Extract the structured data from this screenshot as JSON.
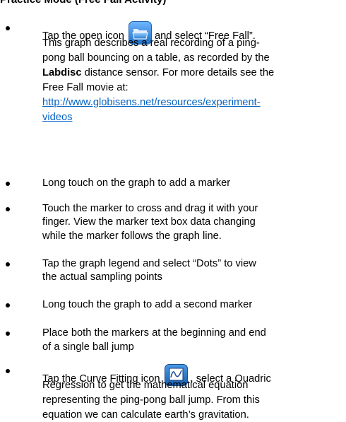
{
  "header_fragment": "Practice Mode (Free Fall Activity)",
  "items": [
    {
      "lines": [
        {
          "segments": [
            {
              "text": "Tap the open icon"
            },
            {
              "icon": "open-icon"
            },
            {
              "text": "and select “Free Fall”."
            }
          ]
        },
        {
          "segments": [
            {
              "text": "This graph describes a real recording of a ping-"
            }
          ]
        },
        {
          "segments": [
            {
              "text": "pong ball bouncing on a table, as recorded by the"
            }
          ]
        },
        {
          "segments": [
            {
              "text": "Labdisc",
              "bold": true
            },
            {
              "text": " distance sensor. For more details see the"
            }
          ]
        },
        {
          "segments": [
            {
              "text": "Free Fall movie at:"
            }
          ]
        },
        {
          "segments": [
            {
              "text": "http://www.globisens.net/resources/experiment-",
              "link": true
            }
          ]
        },
        {
          "segments": [
            {
              "text": "videos",
              "link": true
            }
          ]
        }
      ]
    },
    {
      "lines": [
        {
          "segments": [
            {
              "text": "Long touch on the graph to add a marker"
            }
          ]
        }
      ]
    },
    {
      "lines": [
        {
          "segments": [
            {
              "text": "Touch the marker to cross and drag it with your"
            }
          ]
        },
        {
          "segments": [
            {
              "text": "finger. View the marker text box data changing"
            }
          ]
        },
        {
          "segments": [
            {
              "text": "while the marker follows the graph line."
            }
          ]
        }
      ]
    },
    {
      "lines": [
        {
          "segments": [
            {
              "text": "Tap the graph legend and select “Dots” to view"
            }
          ]
        },
        {
          "segments": [
            {
              "text": "the actual sampling points"
            }
          ]
        }
      ]
    },
    {
      "lines": [
        {
          "segments": [
            {
              "text": "Long touch the graph to add a second marker"
            }
          ]
        }
      ]
    },
    {
      "lines": [
        {
          "segments": [
            {
              "text": "Place both the markers at the beginning and end"
            }
          ]
        },
        {
          "segments": [
            {
              "text": "of a single ball jump"
            }
          ]
        }
      ]
    },
    {
      "lines": [
        {
          "segments": [
            {
              "text": "Tap the Curve Fitting icon"
            },
            {
              "icon": "curve-fitting-icon"
            },
            {
              "text": ", select a Quadric"
            }
          ]
        },
        {
          "segments": [
            {
              "text": "Regression to get the mathematical equation"
            }
          ]
        },
        {
          "segments": [
            {
              "text": "representing the ping-pong ball jump. From this"
            }
          ]
        },
        {
          "segments": [
            {
              "text": "equation we can calculate earth’s gravitation."
            }
          ]
        }
      ]
    }
  ],
  "colors": {
    "text": "#000000",
    "link": "#0563c1",
    "open_icon_blue": "#2b7fd4",
    "curve_icon_blue": "#1f6fc6"
  }
}
